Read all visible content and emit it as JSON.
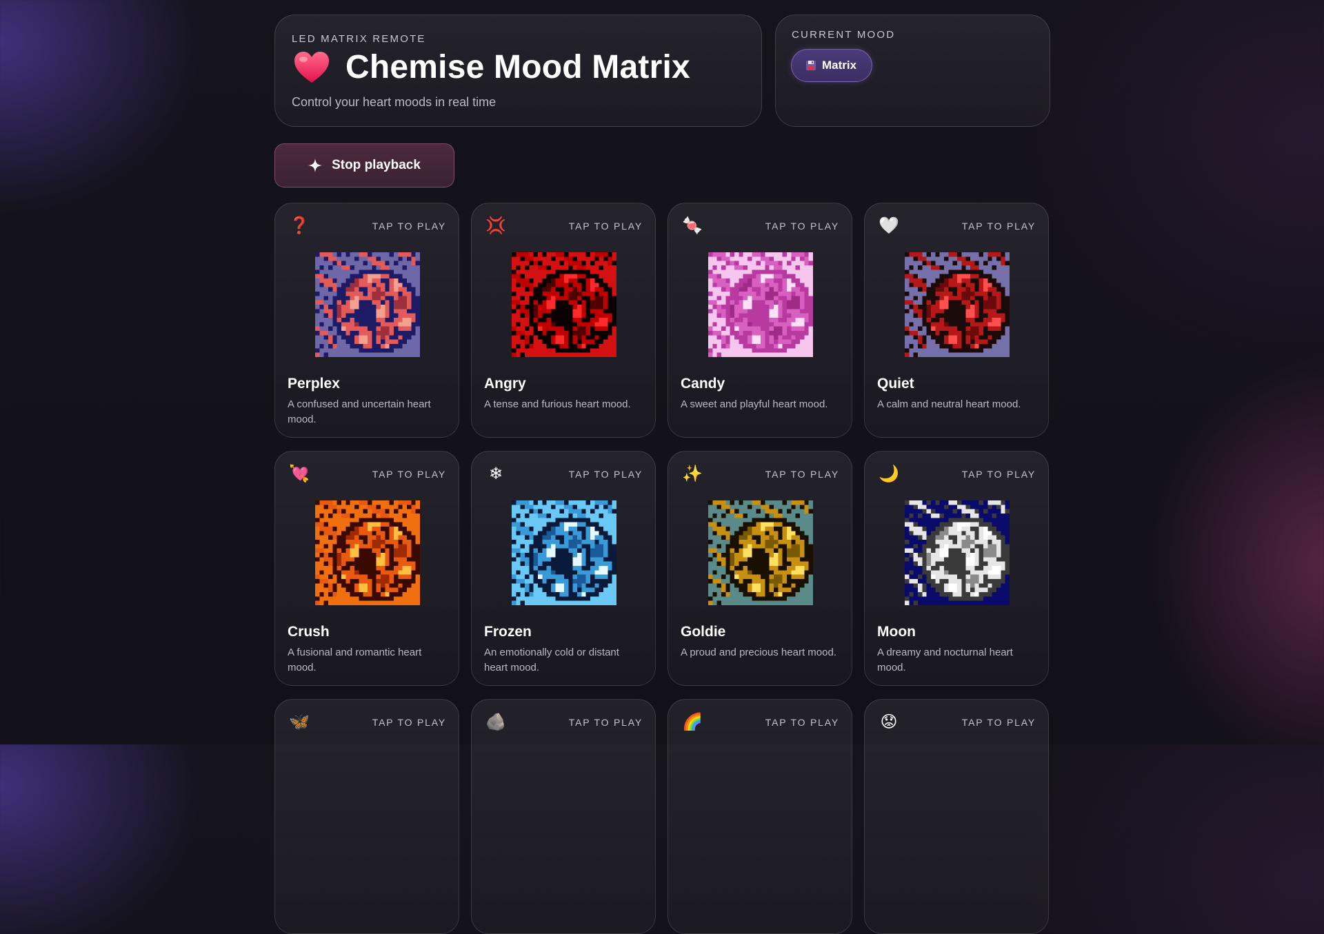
{
  "header": {
    "eyebrow": "LED MATRIX REMOTE",
    "title": "Chemise Mood Matrix",
    "subtitle": "Control your heart moods in real time"
  },
  "current_mood": {
    "eyebrow": "CURRENT MOOD",
    "value": "Matrix",
    "icon": "floppy-disk-icon"
  },
  "controls": {
    "stop_label": "Stop playback",
    "stop_icon": "sparkle-icon"
  },
  "cards": [
    {
      "name": "Perplex",
      "desc": "A confused and uncertain heart mood.",
      "tap": "TAP TO PLAY",
      "icon": "question-mark-icon",
      "glyph": "❓",
      "colors": {
        "bg": "#6f68a8",
        "outline": "#1d1a66",
        "body": "#e25a5a",
        "hi": "#f4a090",
        "dark": "#9b2f3c"
      }
    },
    {
      "name": "Angry",
      "desc": "A tense and furious heart mood.",
      "tap": "TAP TO PLAY",
      "icon": "anger-symbol-icon",
      "glyph": "💢",
      "colors": {
        "bg": "#d41010",
        "outline": "#0a0000",
        "body": "#c00000",
        "hi": "#ff2a2a",
        "dark": "#500000"
      }
    },
    {
      "name": "Candy",
      "desc": "A sweet and playful heart mood.",
      "tap": "TAP TO PLAY",
      "icon": "candy-icon",
      "glyph": "🍬",
      "colors": {
        "bg": "#f7c6ee",
        "outline": "#b83aa0",
        "body": "#d860c0",
        "hi": "#ffe0f6",
        "dark": "#a02a88"
      }
    },
    {
      "name": "Quiet",
      "desc": "A calm and neutral heart mood.",
      "tap": "TAP TO PLAY",
      "icon": "white-heart-icon",
      "glyph": "🤍",
      "colors": {
        "bg": "#7570aa",
        "outline": "#1a0a0a",
        "body": "#b41818",
        "hi": "#ff5050",
        "dark": "#6a0a0a"
      }
    },
    {
      "name": "Crush",
      "desc": "A fusional and romantic heart mood.",
      "tap": "TAP TO PLAY",
      "icon": "heart-with-arrow-icon",
      "glyph": "💘",
      "colors": {
        "bg": "#f07010",
        "outline": "#3a0a00",
        "body": "#e85a10",
        "hi": "#ffc040",
        "dark": "#a02a00"
      }
    },
    {
      "name": "Frozen",
      "desc": "An emotionally cold or distant heart mood.",
      "tap": "TAP TO PLAY",
      "icon": "snowflake-icon",
      "glyph": "❄",
      "colors": {
        "bg": "#6ac8f4",
        "outline": "#0a1a3a",
        "body": "#3a9ad8",
        "hi": "#e8f8ff",
        "dark": "#1a5a98"
      }
    },
    {
      "name": "Goldie",
      "desc": "A proud and precious heart mood.",
      "tap": "TAP TO PLAY",
      "icon": "sparkles-icon",
      "glyph": "✨",
      "colors": {
        "bg": "#5a8a8a",
        "outline": "#1a1000",
        "body": "#c89010",
        "hi": "#ffe060",
        "dark": "#7a5a00"
      }
    },
    {
      "name": "Moon",
      "desc": "A dreamy and nocturnal heart mood.",
      "tap": "TAP TO PLAY",
      "icon": "crescent-moon-icon",
      "glyph": "🌙",
      "colors": {
        "bg": "#0a0a6a",
        "outline": "#3a3a3a",
        "body": "#e6e6e6",
        "hi": "#ffffff",
        "dark": "#8a8a8a"
      }
    },
    {
      "name": "",
      "desc": "",
      "tap": "TAP TO PLAY",
      "icon": "butterfly-icon",
      "glyph": "🦋",
      "colors": {
        "bg": "#333",
        "outline": "#111",
        "body": "#555",
        "hi": "#777",
        "dark": "#222"
      }
    },
    {
      "name": "",
      "desc": "",
      "tap": "TAP TO PLAY",
      "icon": "rock-icon",
      "glyph": "🪨",
      "colors": {
        "bg": "#333",
        "outline": "#111",
        "body": "#555",
        "hi": "#777",
        "dark": "#222"
      }
    },
    {
      "name": "",
      "desc": "",
      "tap": "TAP TO PLAY",
      "icon": "rainbow-icon",
      "glyph": "🌈",
      "colors": {
        "bg": "#333",
        "outline": "#111",
        "body": "#555",
        "hi": "#777",
        "dark": "#222"
      }
    },
    {
      "name": "",
      "desc": "",
      "tap": "TAP TO PLAY",
      "icon": "worried-face-icon",
      "glyph": "😟",
      "colors": {
        "bg": "#333",
        "outline": "#111",
        "body": "#555",
        "hi": "#777",
        "dark": "#222"
      }
    }
  ]
}
